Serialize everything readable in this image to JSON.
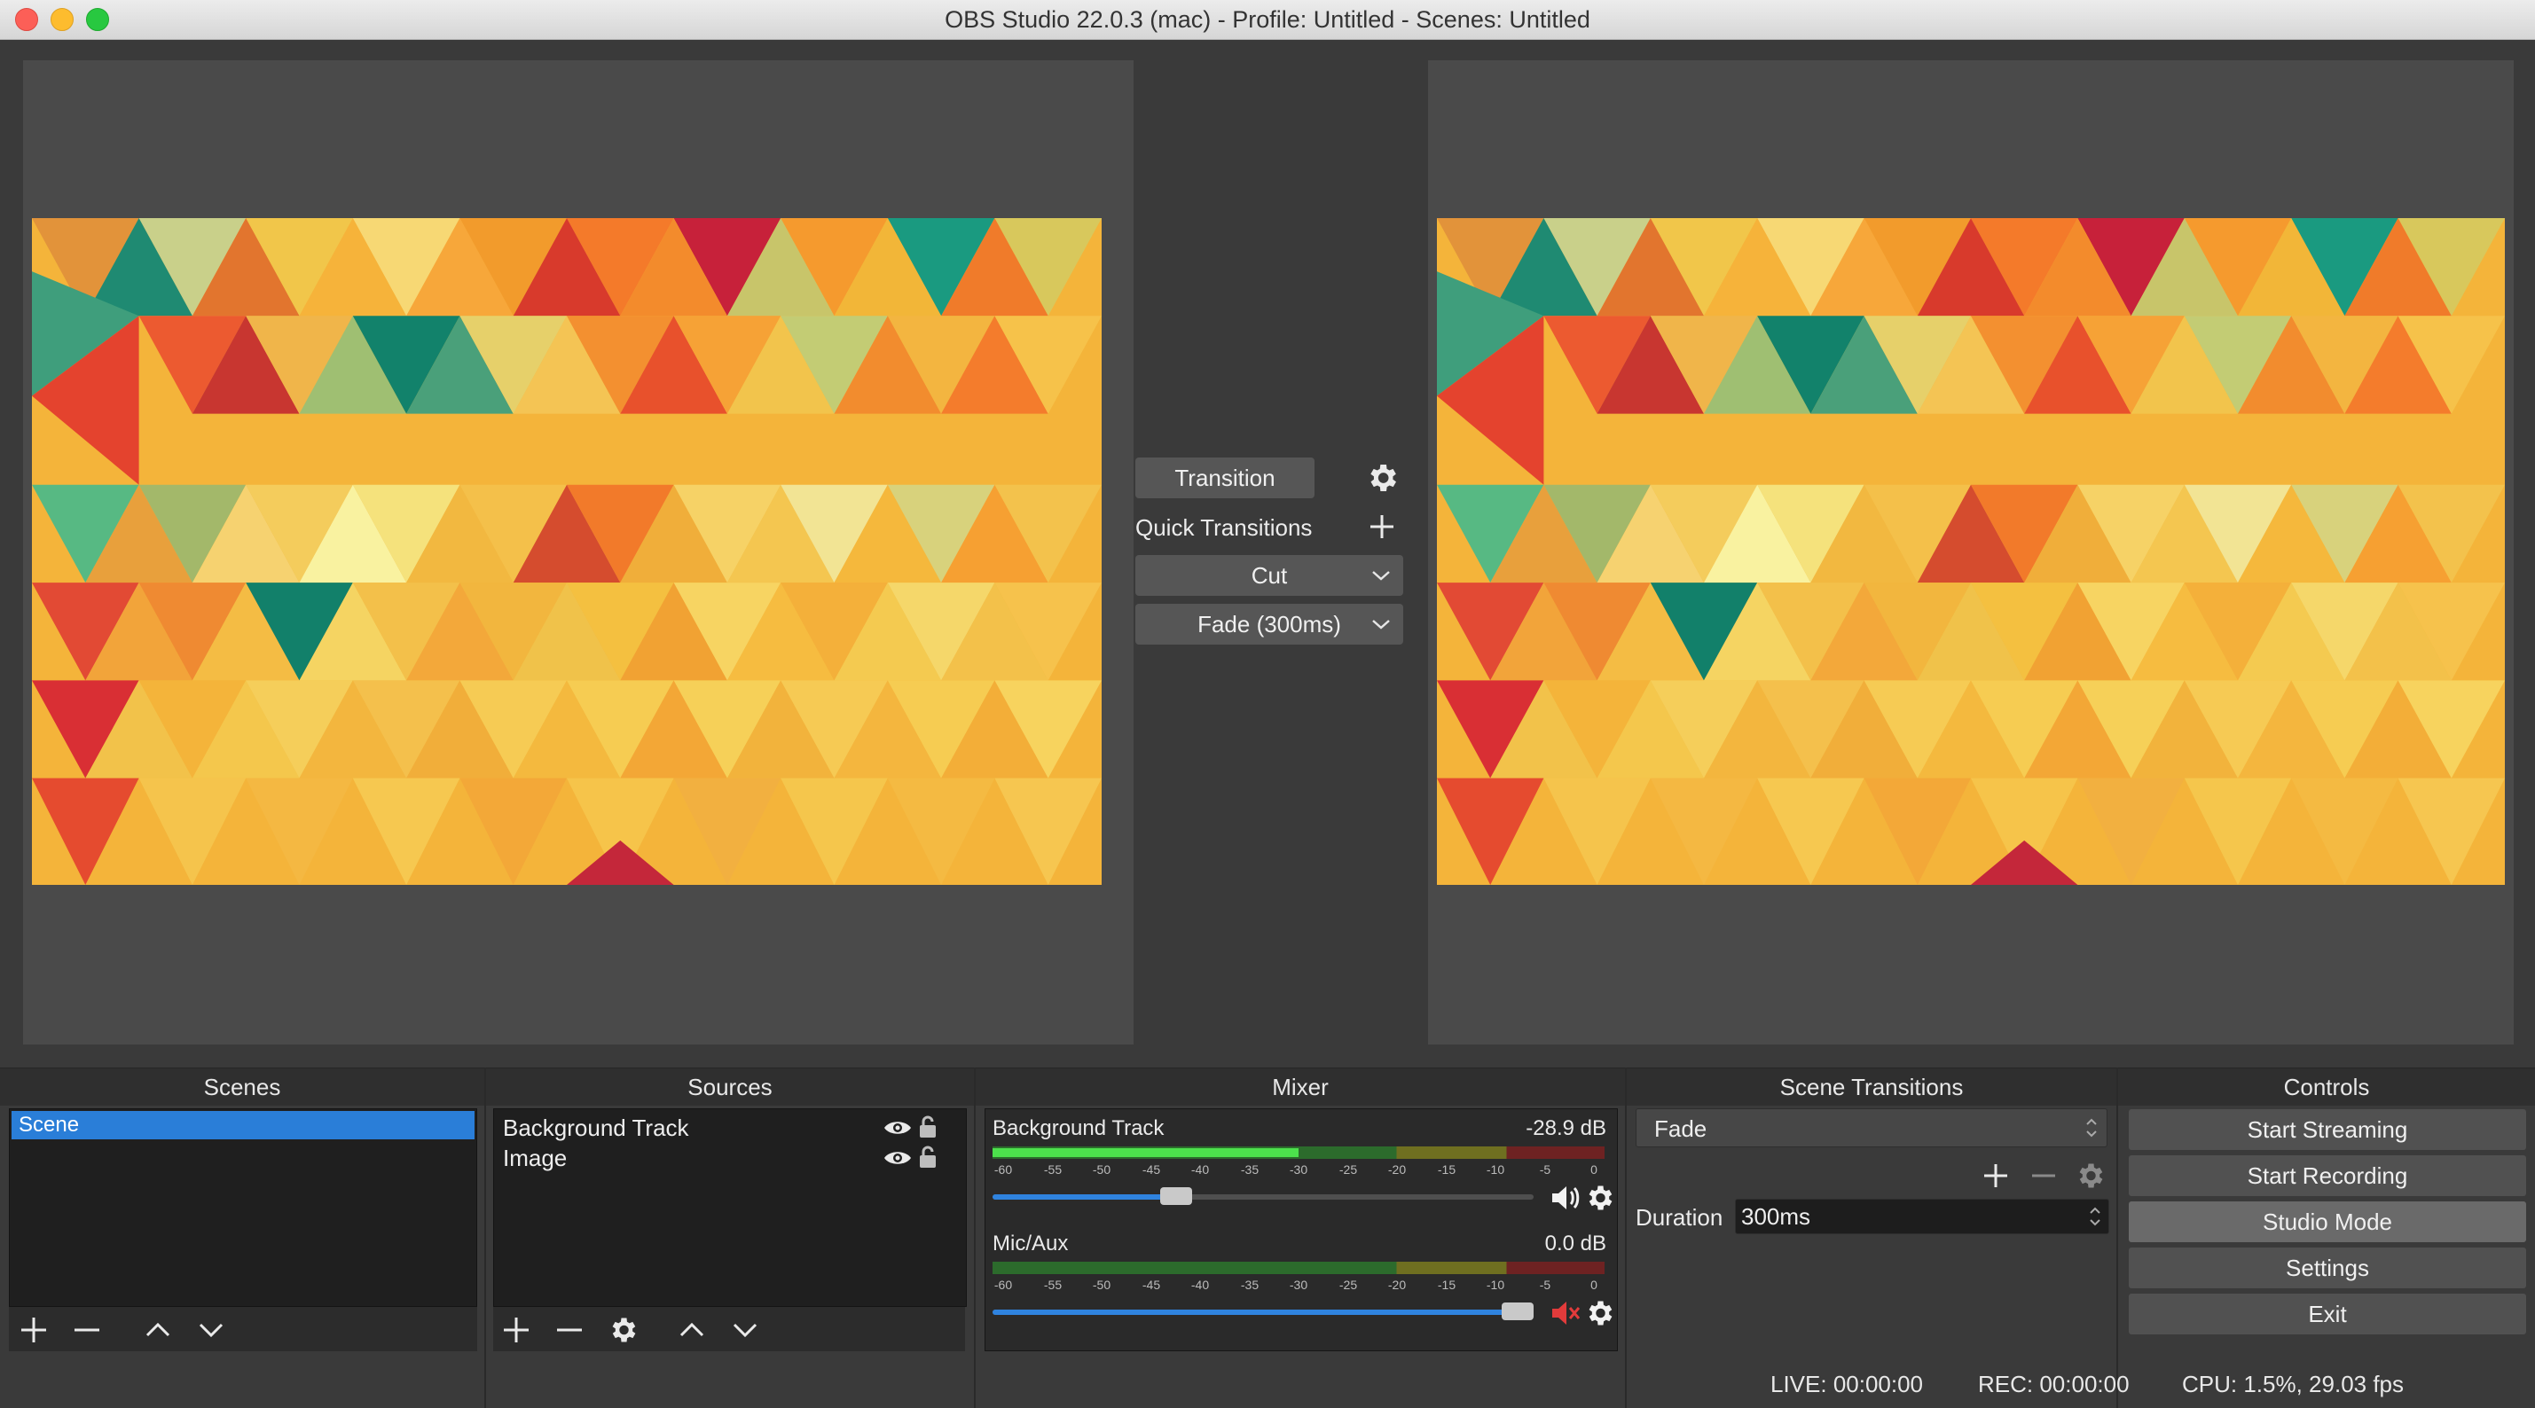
{
  "window": {
    "title": "OBS Studio 22.0.3 (mac) - Profile: Untitled - Scenes: Untitled"
  },
  "transition_panel": {
    "transition_button": "Transition",
    "quick_transitions_label": "Quick Transitions",
    "quick_items": [
      "Cut",
      "Fade (300ms)"
    ]
  },
  "docks": {
    "scenes": {
      "header": "Scenes",
      "items": [
        "Scene"
      ]
    },
    "sources": {
      "header": "Sources",
      "items": [
        "Background Track",
        "Image"
      ]
    },
    "mixer": {
      "header": "Mixer",
      "tick_labels": [
        "-60",
        "-55",
        "-50",
        "-45",
        "-40",
        "-35",
        "-30",
        "-25",
        "-20",
        "-15",
        "-10",
        "-5",
        "0"
      ],
      "channels": [
        {
          "name": "Background Track",
          "db": "-28.9 dB",
          "level_fraction": 0.5,
          "volume_fraction": 0.33,
          "muted": false
        },
        {
          "name": "Mic/Aux",
          "db": "0.0 dB",
          "level_fraction": 0.0,
          "volume_fraction": 1.0,
          "muted": true
        }
      ]
    },
    "scene_transitions": {
      "header": "Scene Transitions",
      "selected": "Fade",
      "duration_label": "Duration",
      "duration_value": "300ms"
    },
    "controls": {
      "header": "Controls",
      "buttons": [
        "Start Streaming",
        "Start Recording",
        "Studio Mode",
        "Settings",
        "Exit"
      ]
    }
  },
  "status_bar": {
    "live": "LIVE: 00:00:00",
    "rec": "REC: 00:00:00",
    "cpu": "CPU: 1.5%, 29.03 fps"
  },
  "colors": {
    "selection_blue": "#2a7ed8",
    "meter_green": "#4ce14c",
    "mute_red": "#e23b3b"
  }
}
